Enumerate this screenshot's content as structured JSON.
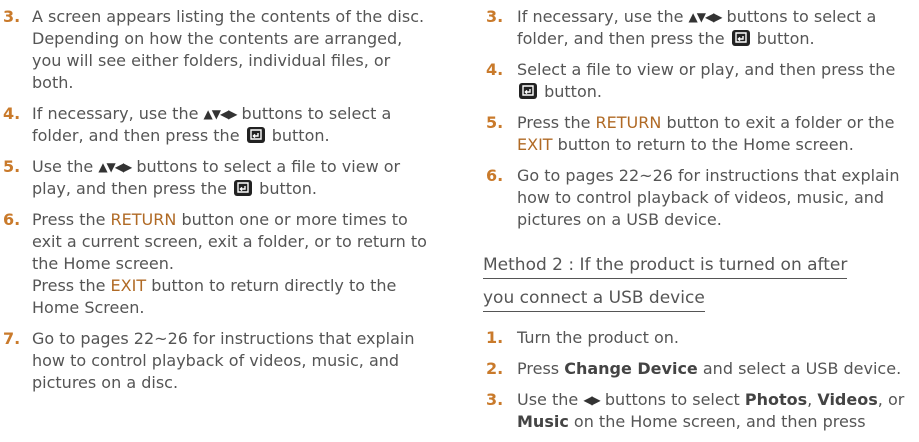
{
  "left": {
    "s3": {
      "num": "3.",
      "text": "A screen appears listing the contents of the disc. Depending on how the contents are arranged, you will see either folders, individual files, or both."
    },
    "s4": {
      "num": "4.",
      "a": "If necessary, use the",
      "b": "buttons to select a folder, and then press the",
      "c": "button."
    },
    "s5": {
      "num": "5.",
      "a": "Use the",
      "b": "buttons to select a file to view or play, and then press the",
      "c": "button."
    },
    "s6": {
      "num": "6.",
      "a": "Press the",
      "b": "RETURN",
      "c": "button one or more times to exit a current screen, exit a folder, or to return to the Home screen.",
      "d": "Press the",
      "e": "EXIT",
      "f": "button to return directly to the Home Screen."
    },
    "s7": {
      "num": "7.",
      "text": "Go to pages 22~26 for instructions that explain how to control playback of videos, music, and pictures on a disc."
    }
  },
  "right": {
    "s3": {
      "num": "3.",
      "a": "If necessary, use the",
      "b": "buttons to select a folder, and then press the",
      "c": "button."
    },
    "s4": {
      "num": "4.",
      "a": "Select a file to view or play, and then press the",
      "c": "button."
    },
    "s5": {
      "num": "5.",
      "a": "Press the",
      "b": "RETURN",
      "c": "button to exit a folder or the",
      "d": "EXIT",
      "e": "button to return to the Home screen."
    },
    "s6": {
      "num": "6.",
      "text": "Go to pages 22~26 for instructions that explain how to control playback of videos, music, and pictures on a USB device."
    },
    "method": {
      "line1": "Method 2 : If the product is turned on after",
      "line2": "you connect a USB device"
    },
    "m1": {
      "num": "1.",
      "text": "Turn the product on."
    },
    "m2": {
      "num": "2.",
      "a": "Press",
      "b": "Change Device",
      "c": "and select a USB device."
    },
    "m3": {
      "num": "3.",
      "a": "Use the",
      "b": "buttons to select",
      "c": "Photos",
      "d": ",",
      "e": "Videos",
      "f": ",",
      "g": "or",
      "h": "Music",
      "i": "on the Home screen, and then press"
    }
  },
  "glyphs": {
    "four_way": "▲▼◀▶",
    "two_way": "◀▶"
  },
  "icons": {
    "enter": "enter-button-icon",
    "color": "#222222"
  },
  "colors": {
    "step_number": "#c97a2b",
    "key_label": "#b06a25",
    "body_text": "#555555"
  }
}
